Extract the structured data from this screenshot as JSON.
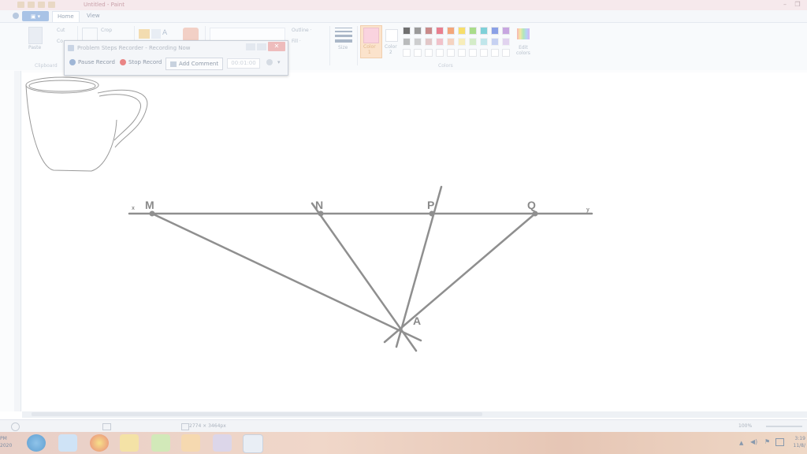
{
  "window": {
    "title": "Untitled - Paint",
    "controls": [
      "–",
      "❐"
    ]
  },
  "tabs": {
    "file": "▣ ▾",
    "home": "Home",
    "view": "View"
  },
  "ribbon": {
    "clipboard": {
      "paste": "Paste",
      "cut": "Cut",
      "copy": "Co",
      "label": "Clipboard"
    },
    "image": {
      "crop": "Crop"
    },
    "outline": "Outline ·",
    "fill": "Fill ·",
    "size": "Size",
    "color1": "Color\n1",
    "color2": "Color\n2",
    "edit_colors": "Edit\ncolors",
    "colors_label": "Colors",
    "palette": [
      "#6f6f6f",
      "#9a9a9a",
      "#c98a8a",
      "#e97f8f",
      "#f3a67a",
      "#f7de6b",
      "#a9dc8a",
      "#7ed0d8",
      "#8aa0e6",
      "#c7a6e0"
    ]
  },
  "recorder": {
    "title": "Problem Steps Recorder - Recording Now",
    "pause": "Pause Record",
    "stop": "Stop Record",
    "comment": "Add Comment",
    "timer": "00:01:00",
    "close": "✕"
  },
  "drawing": {
    "labels": {
      "x": "x",
      "y": "y",
      "M": "M",
      "N": "N",
      "P": "P",
      "Q": "Q",
      "A": "A"
    }
  },
  "status": {
    "dims": "2774 × 3464px",
    "zoom": "100%"
  },
  "taskbar": {
    "left_time": "PM\n2020",
    "clock": "3:19\n11/8/"
  }
}
